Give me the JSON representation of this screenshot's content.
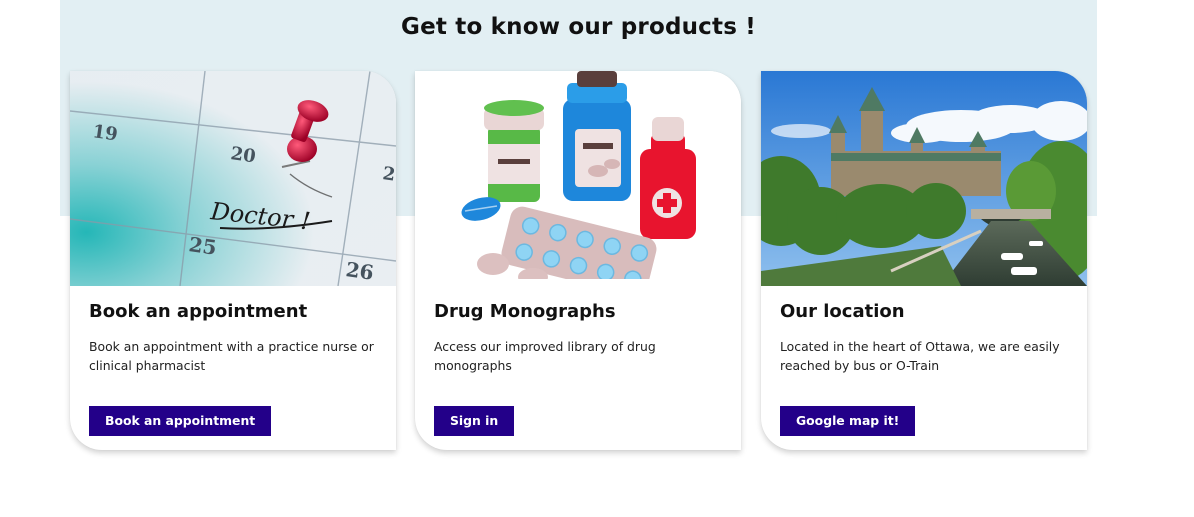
{
  "section": {
    "title": "Get to know our products !"
  },
  "cards": [
    {
      "title": "Book an appointment",
      "description": "Book an appointment with a practice nurse or clinical pharmacist",
      "button": "Book an appointment",
      "image": {
        "icon": "calendar-pin-photo",
        "numbers": [
          "19",
          "20",
          "25",
          "26",
          "2"
        ],
        "handwriting": "Doctor !"
      }
    },
    {
      "title": "Drug Monographs",
      "description": "Access our improved library of drug monographs",
      "button": "Sign in",
      "image": {
        "icon": "medicine-bottles-illustration"
      }
    },
    {
      "title": "Our location",
      "description": "Located in the heart of Ottawa, we are easily reached by bus or O-Train",
      "button": "Google map it!",
      "image": {
        "icon": "parliament-hill-photo"
      }
    }
  ],
  "colors": {
    "band": "#e2eff3",
    "button": "#230089",
    "pin": "#c8103e"
  }
}
